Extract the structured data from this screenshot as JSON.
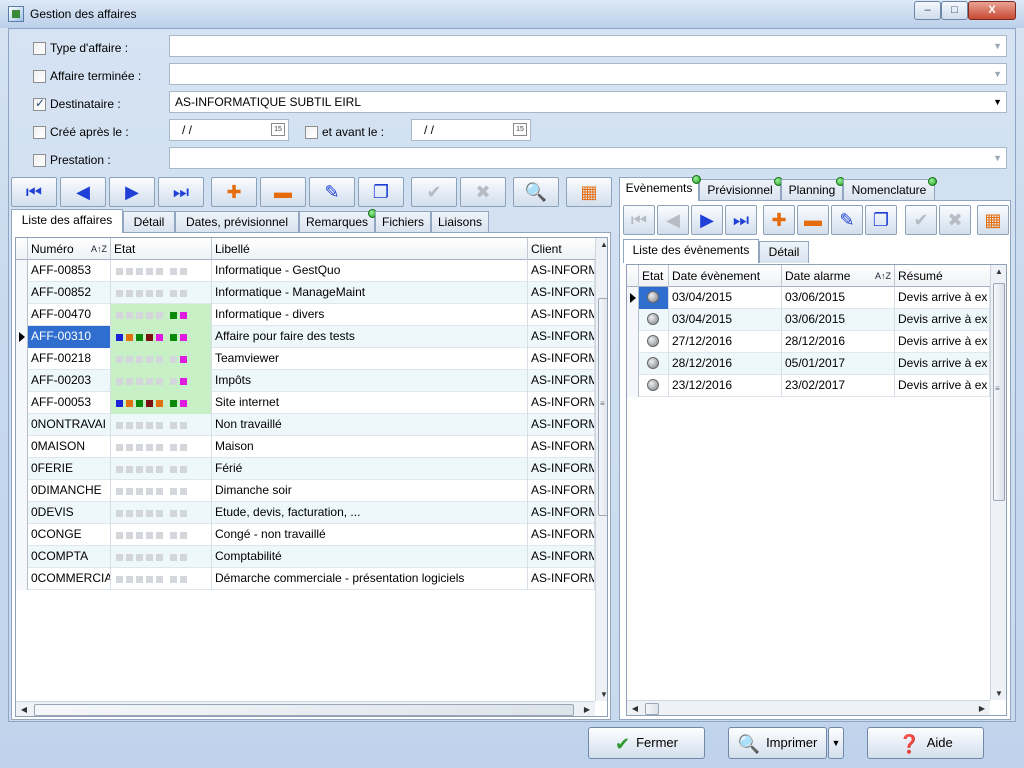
{
  "window": {
    "title": "Gestion des affaires",
    "min": "–",
    "max": "□",
    "close": "X"
  },
  "filters": {
    "type_affaire": {
      "label": "Type d'affaire :",
      "checked": false,
      "value": ""
    },
    "affaire_terminee": {
      "label": "Affaire terminée :",
      "checked": false,
      "value": ""
    },
    "destinataire": {
      "label": "Destinataire :",
      "checked": true,
      "value": "AS-INFORMATIQUE SUBTIL EIRL"
    },
    "cree_apres": {
      "label": "Créé après le :",
      "checked": false,
      "value": "/ /"
    },
    "et_avant": {
      "label": "et avant le :",
      "checked": false,
      "value": "/ /"
    },
    "prestation": {
      "label": "Prestation :",
      "checked": false,
      "value": ""
    }
  },
  "left_tabs": [
    "Liste des affaires",
    "Détail",
    "Dates, prévisionnel",
    "Remarques",
    "Fichiers",
    "Liaisons"
  ],
  "left_grid": {
    "columns": [
      "Numéro",
      "Etat",
      "Libellé",
      "Client"
    ],
    "sort_icon": "A↑Z",
    "rows": [
      {
        "num": "AFF-00853",
        "lib": "Informatique - GestQuo",
        "client": "AS-INFORM",
        "etat": [
          "g",
          "g",
          "g",
          "g",
          "g",
          "g",
          "g"
        ]
      },
      {
        "num": "AFF-00852",
        "lib": "Informatique - ManageMaint",
        "client": "AS-INFORM",
        "etat": [
          "g",
          "g",
          "g",
          "g",
          "g",
          "g",
          "g"
        ]
      },
      {
        "num": "AFF-00470",
        "lib": "Informatique - divers",
        "client": "AS-INFORM",
        "etat": [
          "g",
          "g",
          "g",
          "g",
          "g",
          "#0a8a0a",
          "#e01be0"
        ]
      },
      {
        "num": "AFF-00310",
        "lib": "Affaire pour faire des tests",
        "client": "AS-INFORM",
        "etat": [
          "#1a24d6",
          "#e07010",
          "#0a8a0a",
          "#7a1010",
          "#e01be0",
          "#0a8a0a",
          "#e01be0"
        ]
      },
      {
        "num": "AFF-00218",
        "lib": "Teamviewer",
        "client": "AS-INFORM",
        "etat": [
          "g",
          "g",
          "g",
          "g",
          "g",
          "g",
          "#e01be0"
        ]
      },
      {
        "num": "AFF-00203",
        "lib": "Impôts",
        "client": "AS-INFORM",
        "etat": [
          "g",
          "g",
          "g",
          "g",
          "g",
          "g",
          "#e01be0"
        ]
      },
      {
        "num": "AFF-00053",
        "lib": "Site internet",
        "client": "AS-INFORM",
        "etat": [
          "#1a24d6",
          "#e07010",
          "#0a8a0a",
          "#7a1010",
          "#e07010",
          "#0a8a0a",
          "#e01be0"
        ]
      },
      {
        "num": "0NONTRAVAI",
        "lib": "Non travaillé",
        "client": "AS-INFORM",
        "etat": [
          "g",
          "g",
          "g",
          "g",
          "g",
          "g",
          "g"
        ]
      },
      {
        "num": "0MAISON",
        "lib": "Maison",
        "client": "AS-INFORM",
        "etat": [
          "g",
          "g",
          "g",
          "g",
          "g",
          "g",
          "g"
        ]
      },
      {
        "num": "0FERIE",
        "lib": "Férié",
        "client": "AS-INFORM",
        "etat": [
          "g",
          "g",
          "g",
          "g",
          "g",
          "g",
          "g"
        ]
      },
      {
        "num": "0DIMANCHE",
        "lib": "Dimanche soir",
        "client": "AS-INFORM",
        "etat": [
          "g",
          "g",
          "g",
          "g",
          "g",
          "g",
          "g"
        ]
      },
      {
        "num": "0DEVIS",
        "lib": "Etude, devis, facturation, ...",
        "client": "AS-INFORM",
        "etat": [
          "g",
          "g",
          "g",
          "g",
          "g",
          "g",
          "g"
        ]
      },
      {
        "num": "0CONGE",
        "lib": "Congé - non travaillé",
        "client": "AS-INFORM",
        "etat": [
          "g",
          "g",
          "g",
          "g",
          "g",
          "g",
          "g"
        ]
      },
      {
        "num": "0COMPTA",
        "lib": "Comptabilité",
        "client": "AS-INFORM",
        "etat": [
          "g",
          "g",
          "g",
          "g",
          "g",
          "g",
          "g"
        ]
      },
      {
        "num": "0COMMERCIA",
        "lib": "Démarche commerciale - présentation logiciels",
        "client": "AS-INFORM",
        "etat": [
          "g",
          "g",
          "g",
          "g",
          "g",
          "g",
          "g"
        ]
      }
    ]
  },
  "right_tabs": [
    "Evènements",
    "Prévisionnel",
    "Planning",
    "Nomenclature"
  ],
  "right_subtabs": [
    "Liste des évènements",
    "Détail"
  ],
  "right_grid": {
    "columns": [
      "Etat",
      "Date évènement",
      "Date alarme",
      "Résumé"
    ],
    "rows": [
      {
        "date": "03/04/2015",
        "alarme": "03/06/2015",
        "resume": "Devis arrive à ex"
      },
      {
        "date": "03/04/2015",
        "alarme": "03/06/2015",
        "resume": "Devis arrive à ex"
      },
      {
        "date": "27/12/2016",
        "alarme": "28/12/2016",
        "resume": "Devis arrive à ex"
      },
      {
        "date": "28/12/2016",
        "alarme": "05/01/2017",
        "resume": "Devis arrive à ex"
      },
      {
        "date": "23/12/2016",
        "alarme": "23/02/2017",
        "resume": "Devis arrive à ex"
      }
    ]
  },
  "buttons": {
    "fermer": "Fermer",
    "imprimer": "Imprimer",
    "aide": "Aide"
  },
  "icons": [
    "first-icon",
    "prev-icon",
    "next-icon",
    "last-icon",
    "add-icon",
    "remove-icon",
    "edit-icon",
    "copy-icon",
    "validate-icon",
    "cancel-icon",
    "search-icon",
    "grid-config-icon"
  ]
}
